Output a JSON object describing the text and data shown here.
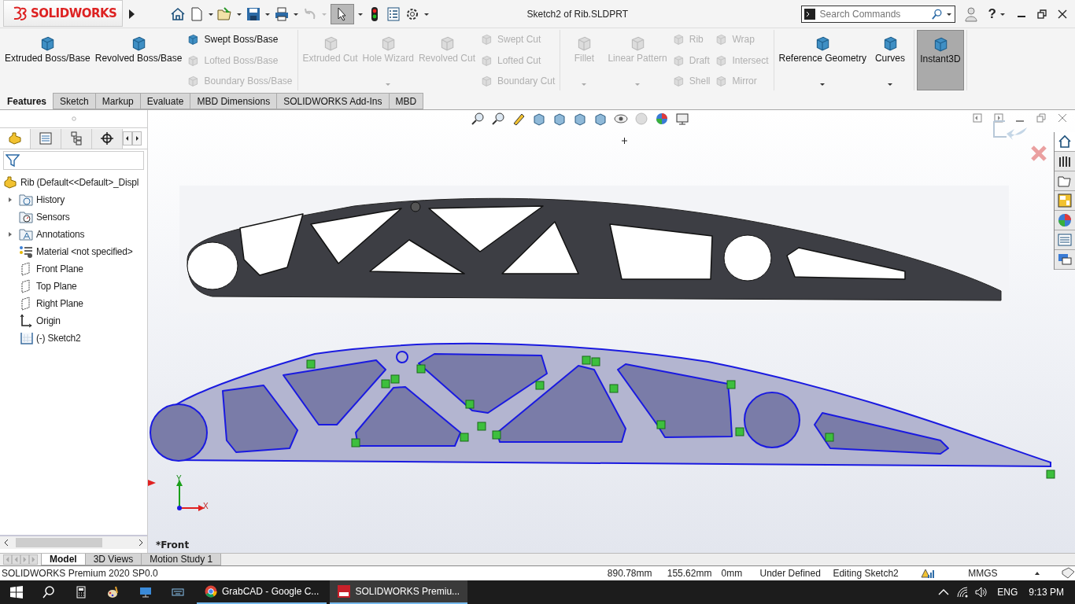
{
  "titlebar": {
    "logo": "SOLIDWORKS",
    "title": "Sketch2 of Rib.SLDPRT",
    "search": {
      "placeholder": "Search Commands"
    },
    "help": "?"
  },
  "ribbon": {
    "groups": [
      {
        "items": [
          {
            "kind": "large",
            "label": "Extruded Boss/Base",
            "enabled": true,
            "dropdown": false,
            "on": false
          },
          {
            "kind": "large",
            "label": "Revolved Boss/Base",
            "enabled": true,
            "dropdown": false,
            "on": false
          },
          {
            "kind": "stack",
            "items": [
              {
                "label": "Swept Boss/Base",
                "enabled": true
              },
              {
                "label": "Lofted Boss/Base",
                "enabled": false
              },
              {
                "label": "Boundary Boss/Base",
                "enabled": false
              }
            ]
          }
        ]
      },
      {
        "items": [
          {
            "kind": "large",
            "label": "Extruded Cut",
            "enabled": false,
            "dropdown": false,
            "on": false
          },
          {
            "kind": "large",
            "label": "Hole Wizard",
            "enabled": false,
            "dropdown": true,
            "on": false
          },
          {
            "kind": "large",
            "label": "Revolved Cut",
            "enabled": false,
            "dropdown": false,
            "on": false
          },
          {
            "kind": "stack",
            "items": [
              {
                "label": "Swept Cut",
                "enabled": false
              },
              {
                "label": "Lofted Cut",
                "enabled": false
              },
              {
                "label": "Boundary Cut",
                "enabled": false
              }
            ]
          }
        ]
      },
      {
        "items": [
          {
            "kind": "large",
            "label": "Fillet",
            "enabled": false,
            "dropdown": true,
            "on": false
          },
          {
            "kind": "large",
            "label": "Linear Pattern",
            "enabled": false,
            "dropdown": true,
            "on": false
          },
          {
            "kind": "stack",
            "items": [
              {
                "label": "Rib",
                "enabled": false
              },
              {
                "label": "Draft",
                "enabled": false
              },
              {
                "label": "Shell",
                "enabled": false
              }
            ]
          },
          {
            "kind": "stack",
            "items": [
              {
                "label": "Wrap",
                "enabled": false
              },
              {
                "label": "Intersect",
                "enabled": false
              },
              {
                "label": "Mirror",
                "enabled": false
              }
            ]
          }
        ]
      },
      {
        "items": [
          {
            "kind": "large",
            "label": "Reference Geometry",
            "enabled": true,
            "dropdown": true,
            "on": false
          },
          {
            "kind": "large",
            "label": "Curves",
            "enabled": true,
            "dropdown": true,
            "on": false
          }
        ]
      },
      {
        "items": [
          {
            "kind": "large",
            "label": "Instant3D",
            "enabled": true,
            "dropdown": false,
            "on": true
          }
        ]
      }
    ]
  },
  "command_tabs": [
    {
      "label": "Features",
      "selected": true
    },
    {
      "label": "Sketch",
      "selected": false
    },
    {
      "label": "Markup",
      "selected": false
    },
    {
      "label": "Evaluate",
      "selected": false
    },
    {
      "label": "MBD Dimensions",
      "selected": false
    },
    {
      "label": "SOLIDWORKS Add-Ins",
      "selected": false
    },
    {
      "label": "MBD",
      "selected": false
    }
  ],
  "panel_tabs": [
    {
      "selected": true
    },
    {
      "selected": false
    },
    {
      "selected": false
    },
    {
      "selected": false
    }
  ],
  "task_pane": [
    {
      "selected": true
    },
    {
      "selected": false
    },
    {
      "selected": false
    },
    {
      "selected": false
    },
    {
      "selected": false
    },
    {
      "selected": false
    },
    {
      "selected": false
    }
  ],
  "feature_tree": {
    "root": {
      "label": "Rib (Default<<Default>_Displ",
      "kind": "part",
      "children": [
        {
          "label": "History",
          "kind": "history-folder",
          "expanded": false
        },
        {
          "label": "Sensors",
          "kind": "sensors-folder"
        },
        {
          "label": "Annotations",
          "kind": "annotations-folder",
          "expanded": false
        },
        {
          "label": "Material <not specified>",
          "kind": "material"
        },
        {
          "label": "Front Plane",
          "kind": "plane"
        },
        {
          "label": "Top Plane",
          "kind": "plane"
        },
        {
          "label": "Right Plane",
          "kind": "plane"
        },
        {
          "label": "Origin",
          "kind": "origin"
        },
        {
          "label": "(-) Sketch2",
          "kind": "sketch"
        }
      ]
    }
  },
  "viewport": {
    "view_name": "*Front",
    "triad": {
      "x_label": "X",
      "y_label": "Y"
    }
  },
  "bottom_tabs": [
    {
      "label": "Model",
      "selected": true
    },
    {
      "label": "3D Views",
      "selected": false
    },
    {
      "label": "Motion Study 1",
      "selected": false
    }
  ],
  "status_bar": {
    "product": "SOLIDWORKS Premium 2020 SP0.0",
    "x": "890.78mm",
    "y": "155.62mm",
    "z": "0mm",
    "state": "Under Defined",
    "mode": "Editing Sketch2",
    "units": "MMGS"
  },
  "taskbar": {
    "apps": [
      {
        "label": "GrabCAD - Google C...",
        "kind": "browser",
        "active": false
      },
      {
        "label": "SOLIDWORKS Premiu...",
        "kind": "solidworks",
        "active": true
      }
    ],
    "language": "ENG",
    "time": "9:13 PM"
  }
}
